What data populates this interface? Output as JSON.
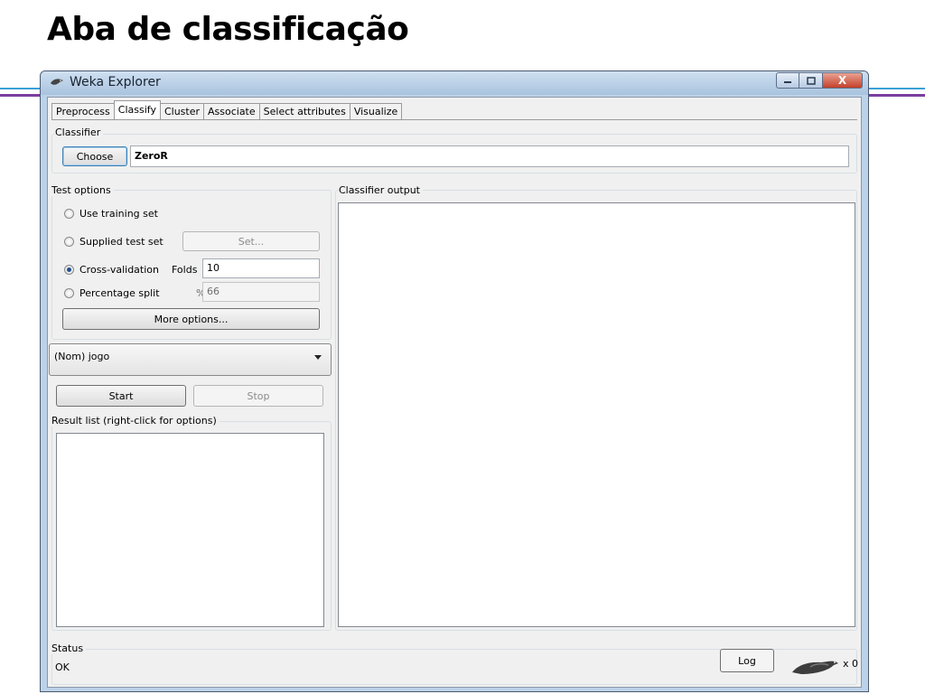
{
  "slide": {
    "title": "Aba de classificação"
  },
  "window": {
    "title": "Weka Explorer",
    "buttons": {
      "minimize": "",
      "maximize": "",
      "close": "X"
    }
  },
  "tabs": [
    {
      "label": "Preprocess",
      "active": false
    },
    {
      "label": "Classify",
      "active": true
    },
    {
      "label": "Cluster",
      "active": false
    },
    {
      "label": "Associate",
      "active": false
    },
    {
      "label": "Select attributes",
      "active": false
    },
    {
      "label": "Visualize",
      "active": false
    }
  ],
  "classifier": {
    "group_label": "Classifier",
    "choose_label": "Choose",
    "value": "ZeroR"
  },
  "test_options": {
    "group_label": "Test options",
    "use_training_set": "Use training set",
    "supplied_test_set": "Supplied test set",
    "set_button": "Set...",
    "cross_validation": "Cross-validation",
    "folds_label": "Folds",
    "folds_value": "10",
    "percentage_split": "Percentage split",
    "percent_symbol": "%",
    "percent_value": "66",
    "more_options": "More options...",
    "selected": "cross_validation"
  },
  "class_attribute": {
    "value": "(Nom) jogo"
  },
  "run": {
    "start_label": "Start",
    "stop_label": "Stop"
  },
  "result_list": {
    "label": "Result list (right-click for options)"
  },
  "output": {
    "label": "Classifier output"
  },
  "status": {
    "group_label": "Status",
    "text": "OK",
    "log_label": "Log",
    "count": "x 0"
  },
  "colors": {
    "accent_blue": "#3aa0d8",
    "accent_purple": "#7b3fa0",
    "window_frame": "#bcd2e8",
    "close_red": "#c4402a"
  }
}
